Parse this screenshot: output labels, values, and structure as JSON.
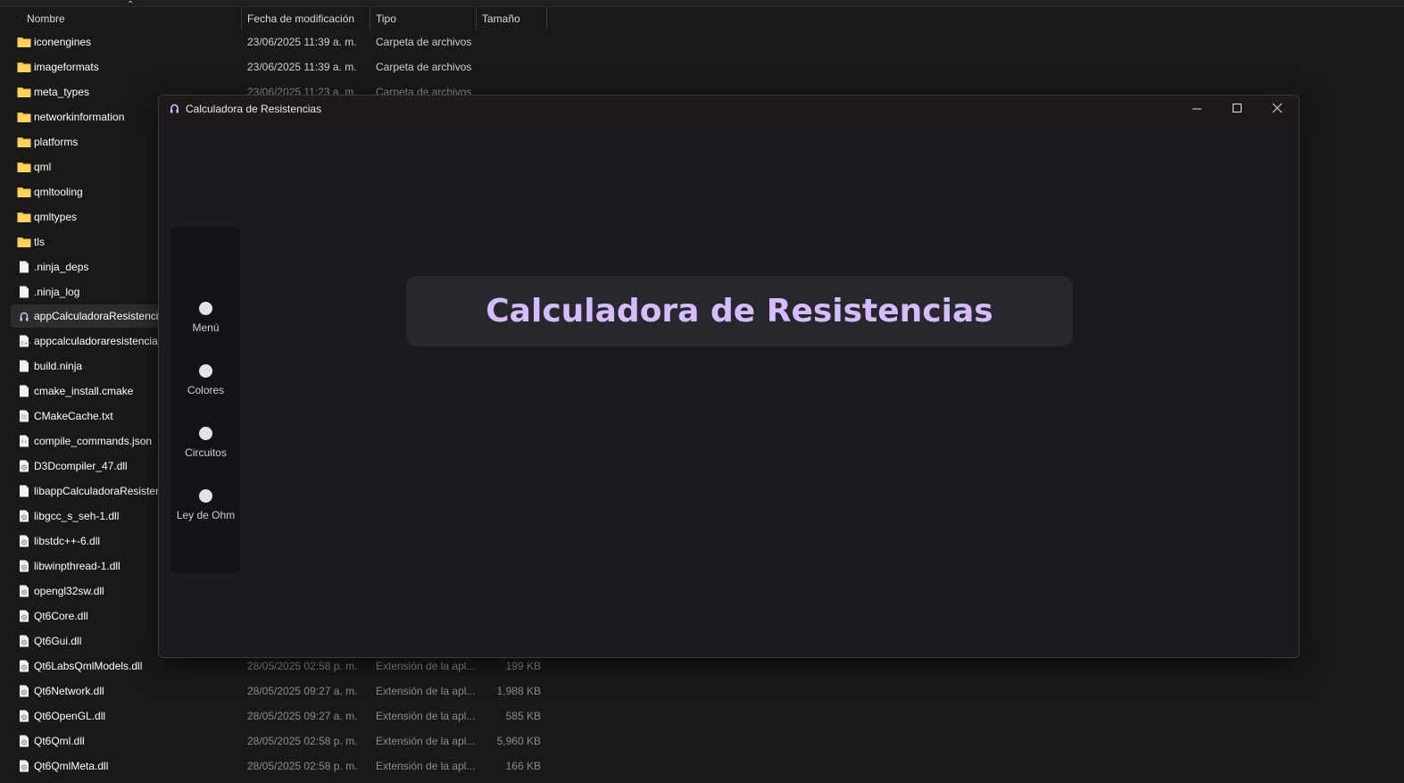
{
  "explorer": {
    "columns": {
      "name": "Nombre",
      "modified": "Fecha de modificación",
      "type": "Tipo",
      "size": "Tamaño"
    },
    "rows": [
      {
        "name": "iconengines",
        "icon": "folder-icon",
        "date": "23/06/2025 11:39 a. m.",
        "type": "Carpeta de archivos",
        "size": ""
      },
      {
        "name": "imageformats",
        "icon": "folder-icon",
        "date": "23/06/2025 11:39 a. m.",
        "type": "Carpeta de archivos",
        "size": ""
      },
      {
        "name": "meta_types",
        "icon": "folder-icon",
        "date": "23/06/2025 11:23 a. m.",
        "type": "Carpeta de archivos",
        "size": ""
      },
      {
        "name": "networkinformation",
        "icon": "folder-icon",
        "date": "",
        "type": "",
        "size": ""
      },
      {
        "name": "platforms",
        "icon": "folder-icon",
        "date": "",
        "type": "",
        "size": ""
      },
      {
        "name": "qml",
        "icon": "folder-icon",
        "date": "",
        "type": "",
        "size": ""
      },
      {
        "name": "qmltooling",
        "icon": "folder-icon",
        "date": "",
        "type": "",
        "size": ""
      },
      {
        "name": "qmltypes",
        "icon": "folder-icon",
        "date": "",
        "type": "",
        "size": ""
      },
      {
        "name": "tls",
        "icon": "folder-icon",
        "date": "",
        "type": "",
        "size": ""
      },
      {
        "name": ".ninja_deps",
        "icon": "file-icon",
        "date": "",
        "type": "",
        "size": ""
      },
      {
        "name": ".ninja_log",
        "icon": "file-icon",
        "date": "",
        "type": "",
        "size": ""
      },
      {
        "name": "appCalculadoraResistencia",
        "icon": "app-exe-icon",
        "date": "",
        "type": "",
        "size": "",
        "selected": true
      },
      {
        "name": "appcalculadoraresistencia_",
        "icon": "cpp-file-icon",
        "date": "",
        "type": "",
        "size": ""
      },
      {
        "name": "build.ninja",
        "icon": "file-icon",
        "date": "",
        "type": "",
        "size": ""
      },
      {
        "name": "cmake_install.cmake",
        "icon": "file-icon",
        "date": "",
        "type": "",
        "size": ""
      },
      {
        "name": "CMakeCache.txt",
        "icon": "text-file-icon",
        "date": "",
        "type": "",
        "size": ""
      },
      {
        "name": "compile_commands.json",
        "icon": "json-file-icon",
        "date": "",
        "type": "",
        "size": ""
      },
      {
        "name": "D3Dcompiler_47.dll",
        "icon": "dll-file-icon",
        "date": "",
        "type": "",
        "size": ""
      },
      {
        "name": "libappCalculadoraResistenc",
        "icon": "file-icon",
        "date": "",
        "type": "",
        "size": ""
      },
      {
        "name": "libgcc_s_seh-1.dll",
        "icon": "dll-file-icon",
        "date": "",
        "type": "",
        "size": ""
      },
      {
        "name": "libstdc++-6.dll",
        "icon": "dll-file-icon",
        "date": "",
        "type": "",
        "size": ""
      },
      {
        "name": "libwinpthread-1.dll",
        "icon": "dll-file-icon",
        "date": "",
        "type": "",
        "size": ""
      },
      {
        "name": "opengl32sw.dll",
        "icon": "dll-file-icon",
        "date": "",
        "type": "",
        "size": ""
      },
      {
        "name": "Qt6Core.dll",
        "icon": "dll-file-icon",
        "date": "",
        "type": "",
        "size": ""
      },
      {
        "name": "Qt6Gui.dll",
        "icon": "dll-file-icon",
        "date": "",
        "type": "",
        "size": ""
      },
      {
        "name": "Qt6LabsQmlModels.dll",
        "icon": "dll-file-icon",
        "date": "28/05/2025 02:58 p. m.",
        "type": "Extensión de la apl...",
        "size": "199 KB"
      },
      {
        "name": "Qt6Network.dll",
        "icon": "dll-file-icon",
        "date": "28/05/2025 09:27 a. m.",
        "type": "Extensión de la apl...",
        "size": "1,988 KB"
      },
      {
        "name": "Qt6OpenGL.dll",
        "icon": "dll-file-icon",
        "date": "28/05/2025 09:27 a. m.",
        "type": "Extensión de la apl...",
        "size": "585 KB"
      },
      {
        "name": "Qt6Qml.dll",
        "icon": "dll-file-icon",
        "date": "28/05/2025 02:58 p. m.",
        "type": "Extensión de la apl...",
        "size": "5,960 KB"
      },
      {
        "name": "Qt6QmlMeta.dll",
        "icon": "dll-file-icon",
        "date": "28/05/2025 02:58 p. m.",
        "type": "Extensión de la apl...",
        "size": "166 KB"
      }
    ]
  },
  "app": {
    "window_title": "Calculadora de Resistencias",
    "heading": "Calculadora de Resistencias",
    "nav": [
      {
        "label": "Menú"
      },
      {
        "label": "Colores"
      },
      {
        "label": "Circuitos"
      },
      {
        "label": "Ley de Ohm"
      }
    ],
    "buttons": {
      "minimize": "minimize-icon",
      "maximize": "maximize-icon",
      "close": "close-icon"
    },
    "colors": {
      "accent": "#d4bcff",
      "window_bg": "#1b1a20",
      "sidebar_bg": "#141218",
      "card_bg": "#29272e",
      "folder": "#f5c542"
    }
  }
}
